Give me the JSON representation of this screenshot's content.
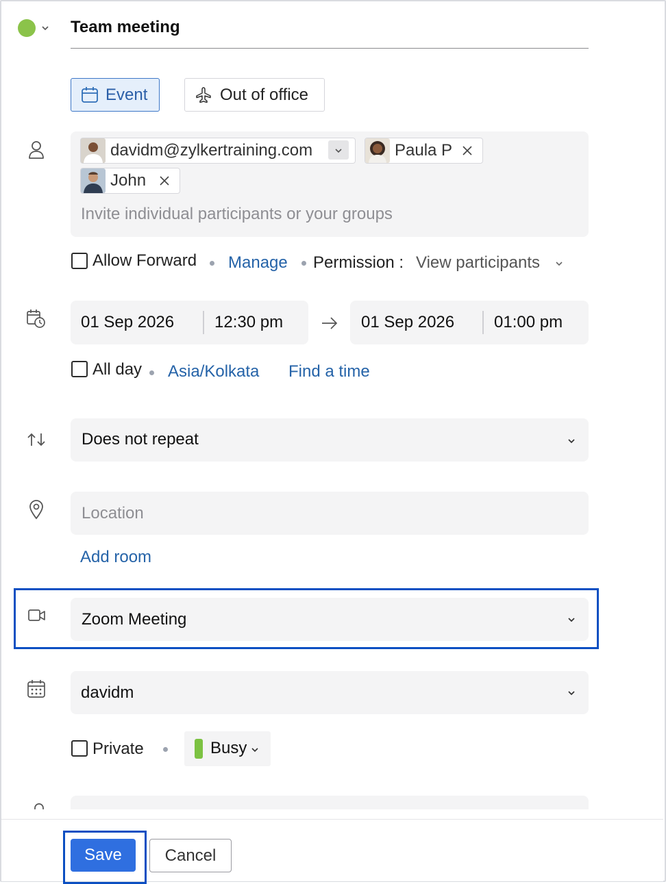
{
  "title": "Team meeting",
  "color_dot": "#8bc34a",
  "event_type": {
    "event_label": "Event",
    "ooo_label": "Out of office"
  },
  "participants": {
    "organizer": "davidm@zylkertraining.com",
    "chips": [
      "Paula P",
      "John"
    ],
    "placeholder": "Invite individual participants or your groups"
  },
  "forward": {
    "allow_label": "Allow Forward",
    "manage_label": "Manage",
    "permission_label": "Permission :",
    "permission_value": "View participants"
  },
  "datetime": {
    "start_date": "01 Sep 2026",
    "start_time": "12:30 pm",
    "end_date": "01 Sep 2026",
    "end_time": "01:00 pm",
    "allday_label": "All day",
    "timezone": "Asia/Kolkata",
    "find_time": "Find a time"
  },
  "repeat": {
    "value": "Does not repeat"
  },
  "location": {
    "placeholder": "Location",
    "add_room": "Add room"
  },
  "conference": {
    "value": "Zoom Meeting"
  },
  "calendar": {
    "value": "davidm"
  },
  "visibility": {
    "private_label": "Private",
    "status": "Busy",
    "status_color": "#7cc242"
  },
  "footer": {
    "save_label": "Save",
    "cancel_label": "Cancel"
  },
  "colors": {
    "accent": "#2f6fe0",
    "highlight_border": "#0b4fc2",
    "link": "#2563a8"
  }
}
